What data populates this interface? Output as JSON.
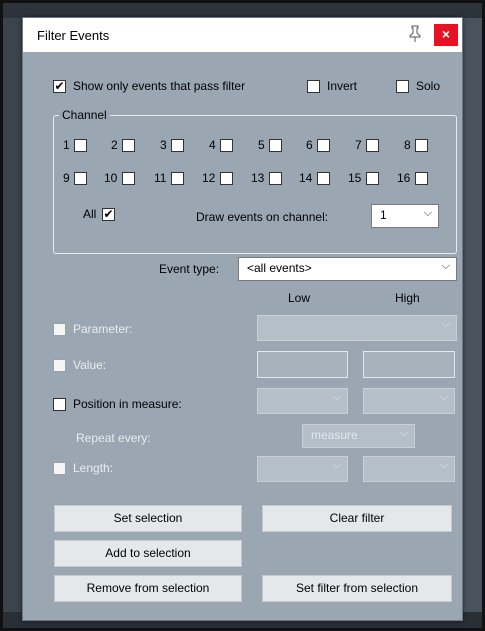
{
  "dialog": {
    "title": "Filter Events",
    "pin_icon": "pin-icon",
    "close_icon": "close-icon",
    "close_glyph": "×",
    "close_color": "#e81123"
  },
  "filter": {
    "show_only_label": "Show only events that pass filter",
    "show_only_checked": true,
    "invert_label": "Invert",
    "invert_checked": false,
    "solo_label": "Solo",
    "solo_checked": false
  },
  "channel": {
    "group_label": "Channel",
    "row1": [
      "1",
      "2",
      "3",
      "4",
      "5",
      "6",
      "7",
      "8"
    ],
    "row2": [
      "9",
      "10",
      "11",
      "12",
      "13",
      "14",
      "15",
      "16"
    ],
    "all_label": "All",
    "all_checked": true,
    "draw_label": "Draw events on channel:",
    "draw_value": "1"
  },
  "event_type": {
    "label": "Event type:",
    "value": "<all events>"
  },
  "columns": {
    "low": "Low",
    "high": "High"
  },
  "params": {
    "parameter_label": "Parameter:",
    "value_label": "Value:",
    "position_label": "Position in measure:",
    "repeat_label": "Repeat every:",
    "repeat_value": "measure",
    "length_label": "Length:"
  },
  "buttons": {
    "set_selection": "Set selection",
    "clear_filter": "Clear filter",
    "add_to_selection": "Add to selection",
    "remove_from_selection": "Remove from selection",
    "set_filter_from_selection": "Set filter from selection"
  },
  "glyphs": {
    "check": "✔",
    "dropdown": "⌵"
  }
}
